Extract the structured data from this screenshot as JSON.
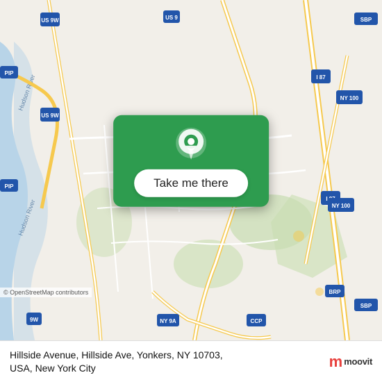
{
  "map": {
    "background_color": "#f2efe9",
    "center_lat": 40.98,
    "center_lng": -73.88
  },
  "button": {
    "label": "Take me there",
    "card_color": "#2e9c4f",
    "pin_color": "#ffffff"
  },
  "bottom_bar": {
    "address_line1": "Hillside Avenue, Hillside Ave, Yonkers, NY 10703,",
    "address_line2": "USA, New York City",
    "logo_letter": "m",
    "logo_text": "moovit"
  },
  "attribution": {
    "text": "© OpenStreetMap contributors"
  },
  "highway_labels": [
    "US 9W",
    "US 9W",
    "US 9",
    "PIP",
    "PIP",
    "I 87",
    "I 87",
    "NY 100",
    "NY 100",
    "NY 9A",
    "9W",
    "CCP",
    "BRP",
    "SBP",
    "SBP"
  ],
  "road_colors": {
    "highway": "#f6c94e",
    "major": "#ffffff",
    "minor": "#e8e0d8",
    "water": "#a8c8e8",
    "green": "#c8ddb0"
  }
}
